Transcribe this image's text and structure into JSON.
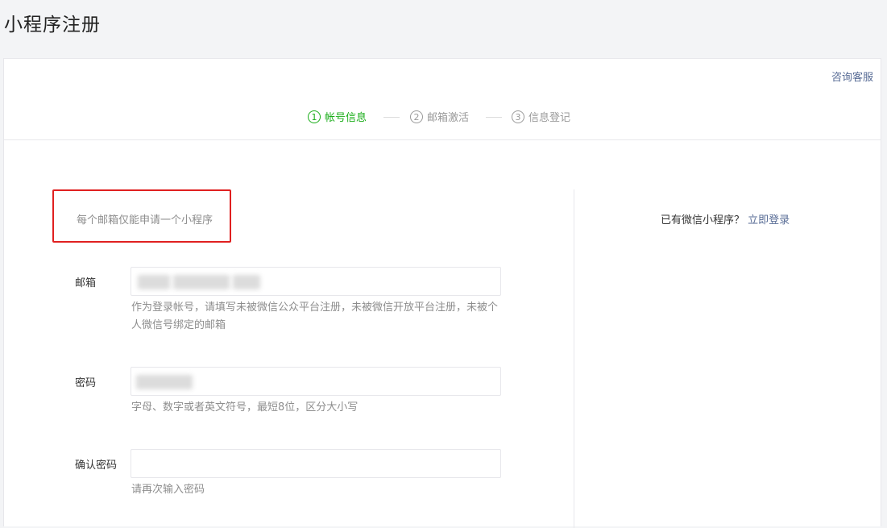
{
  "page": {
    "title": "小程序注册"
  },
  "header": {
    "help_link": "咨询客服"
  },
  "steps": [
    {
      "num": "1",
      "label": "帐号信息",
      "active": true
    },
    {
      "num": "2",
      "label": "邮箱激活",
      "active": false
    },
    {
      "num": "3",
      "label": "信息登记",
      "active": false
    }
  ],
  "notice": "每个邮箱仅能申请一个小程序",
  "form": {
    "email": {
      "label": "邮箱",
      "value": "",
      "tip": "作为登录帐号，请填写未被微信公众平台注册，未被微信开放平台注册，未被个人微信号绑定的邮箱"
    },
    "password": {
      "label": "密码",
      "value": "",
      "tip": "字母、数字或者英文符号，最短8位，区分大小写"
    },
    "confirm_password": {
      "label": "确认密码",
      "value": "",
      "tip": "请再次输入密码"
    }
  },
  "sidebar": {
    "login_prompt": "已有微信小程序？",
    "login_link": "立即登录"
  },
  "colors": {
    "active_step": "#1aad19",
    "link": "#576b95",
    "highlight_border": "#e02020"
  }
}
